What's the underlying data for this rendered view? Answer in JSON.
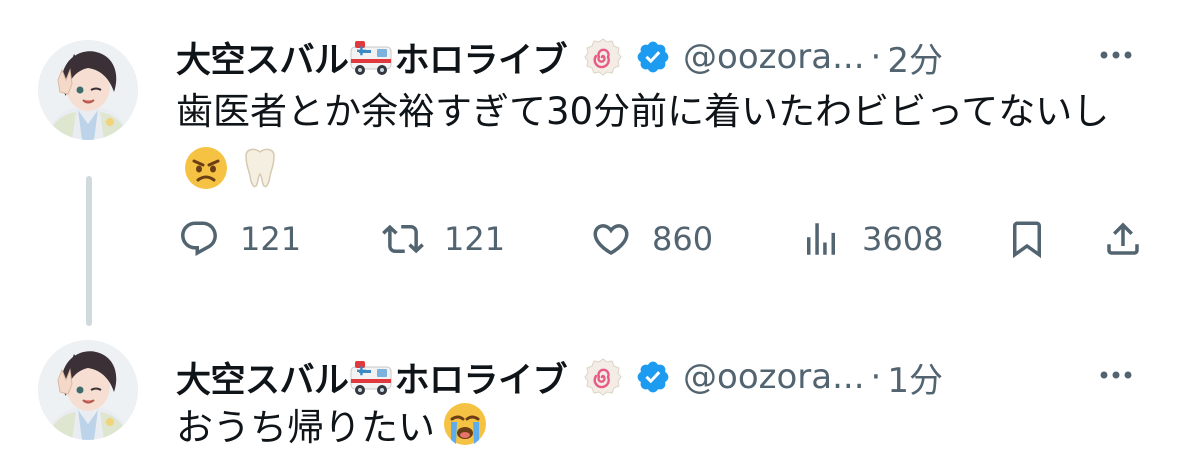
{
  "tweets": [
    {
      "display_name": "大空スバル",
      "display_name_suffix": "ホロライブ",
      "name_emoji": "ambulance-icon",
      "badge_emoji": "narutomaki-icon",
      "verified": true,
      "handle": "@oozora...",
      "separator": "·",
      "time": "2分",
      "text": "歯医者とか余裕すぎて30分前に着いたわビビってないし",
      "text_emojis": [
        "angry-face-icon",
        "tooth-icon"
      ],
      "stats": {
        "replies": "121",
        "retweets": "121",
        "likes": "860",
        "views": "3608"
      }
    },
    {
      "display_name": "大空スバル",
      "display_name_suffix": "ホロライブ",
      "name_emoji": "ambulance-icon",
      "badge_emoji": "narutomaki-icon",
      "verified": true,
      "handle": "@oozora...",
      "separator": "·",
      "time": "1分",
      "text": "おうち帰りたい",
      "text_emojis": [
        "loudly-crying-face-icon"
      ]
    }
  ],
  "colors": {
    "verified_blue": "#1d9bf0",
    "secondary_text": "#536471",
    "thread_line": "#cfd9de",
    "primary_text": "#0f1419"
  }
}
